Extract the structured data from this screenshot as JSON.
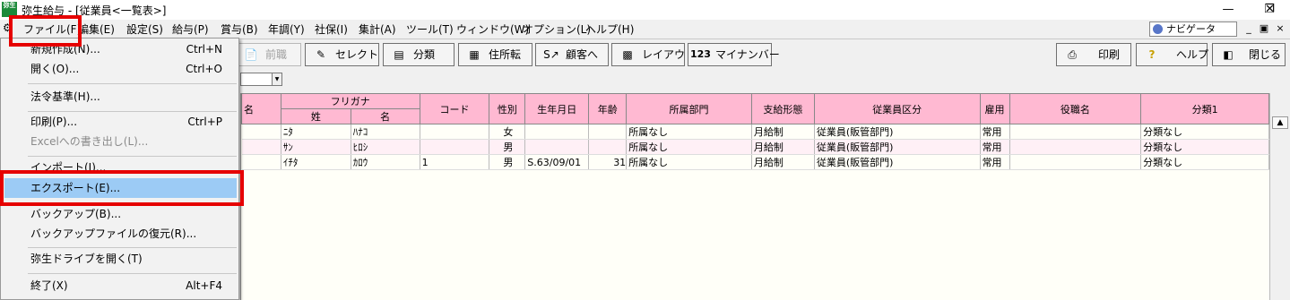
{
  "window": {
    "title": "弥生給与 - [従業員<一覧表>]",
    "app_icon_text": "弥生"
  },
  "menubar": {
    "items": [
      "ファイル(F)",
      "編集(E)",
      "設定(S)",
      "給与(P)",
      "賞与(B)",
      "年調(Y)",
      "社保(I)",
      "集計(A)",
      "ツール(T)",
      "ウィンドウ(W)",
      "オプション(L)",
      "ヘルプ(H)"
    ],
    "navigator_label": "ナビゲータ"
  },
  "toolbar": {
    "prev_label": "前職",
    "select_label": "セレクト",
    "classify_label": "分類",
    "move_label": "住所転",
    "customer_label": "顧客へ",
    "layout_label": "レイアウト",
    "mynumber_label": "マイナンバー",
    "mynumber_icon_text": "123",
    "print_label": "印刷",
    "help_label": "ヘルプ",
    "close_label": "閉じる"
  },
  "file_menu": {
    "new": "新規作成(N)...",
    "new_sc": "Ctrl+N",
    "open": "開く(O)...",
    "open_sc": "Ctrl+O",
    "law": "法令基準(H)...",
    "print": "印刷(P)...",
    "print_sc": "Ctrl+P",
    "excel": "Excelへの書き出し(L)...",
    "import": "インポート(I)...",
    "export": "エクスポート(E)...",
    "backup": "バックアップ(B)...",
    "restore": "バックアップファイルの復元(R)...",
    "drive": "弥生ドライブを開く(T)",
    "exit": "終了(X)",
    "exit_sc": "Alt+F4"
  },
  "table": {
    "header_partial_name": "名",
    "header_furigana": "フリガナ",
    "header_sei": "姓",
    "header_mei": "名",
    "header_code": "コード",
    "header_gender": "性別",
    "header_birth": "生年月日",
    "header_age": "年齢",
    "header_dept": "所属部門",
    "header_pay": "支給形態",
    "header_emptype": "従業員区分",
    "header_hire": "雇用",
    "header_title": "役職名",
    "header_cat1": "分類1",
    "rows": [
      {
        "sei": "ﾆﾀ",
        "mei": "ﾊﾅｺ",
        "code": "",
        "gender": "女",
        "birth": "",
        "age": "",
        "dept": "所属なし",
        "pay": "月給制",
        "emptype": "従業員(販管部門)",
        "hire": "常用",
        "title": "",
        "cat1": "分類なし"
      },
      {
        "sei": "ｻﾝ",
        "mei": "ﾋﾛｼ",
        "code": "",
        "gender": "男",
        "birth": "",
        "age": "",
        "dept": "所属なし",
        "pay": "月給制",
        "emptype": "従業員(販管部門)",
        "hire": "常用",
        "title": "",
        "cat1": "分類なし"
      },
      {
        "sei": "ｲﾁﾀ",
        "mei": "ｶﾛｳ",
        "code": "1",
        "gender": "男",
        "birth": "S.63/09/01",
        "age": "31",
        "dept": "所属なし",
        "pay": "月給制",
        "emptype": "従業員(販管部門)",
        "hire": "常用",
        "title": "",
        "cat1": "分類なし"
      }
    ]
  },
  "colors": {
    "header_bg": "#ffb9d2",
    "highlight": "#9ccbf5",
    "annotation_red": "#e60000"
  }
}
